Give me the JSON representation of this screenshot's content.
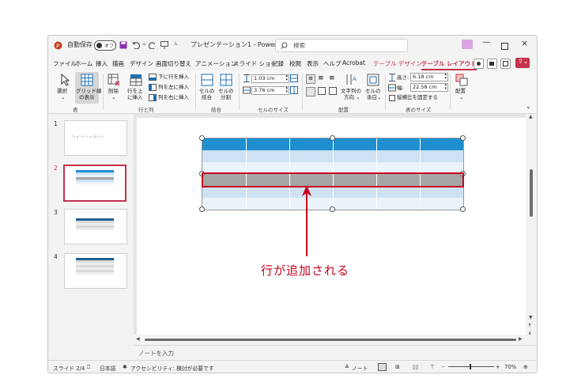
{
  "titlebar": {
    "autosave_label": "自動保存",
    "autosave_state": "オフ",
    "doc_title": "プレゼンテーション1 - Power…",
    "search_placeholder": "検索"
  },
  "menu": {
    "items": [
      "ファイル",
      "ホーム",
      "挿入",
      "描画",
      "デザイン",
      "画面切り替え",
      "アニメーション",
      "スライド ショー",
      "記録",
      "校閲",
      "表示",
      "ヘルプ",
      "Acrobat",
      "テーブル デザイン",
      "テーブル レイアウト"
    ],
    "active_index": 14
  },
  "ribbon": {
    "select": "選択",
    "gridlines_line1": "グリッド線",
    "gridlines_line2": "の表示",
    "delete": "削除",
    "insert_above_line1": "行を上",
    "insert_above_line2": "に挿入",
    "insert_below": "下に行を挿入",
    "insert_left": "列を左に挿入",
    "insert_right": "列を右に挿入",
    "merge_line1": "セルの",
    "merge_line2": "結合",
    "split_line1": "セルの",
    "split_line2": "分割",
    "row_height": "1.03 cm",
    "col_width": "3.76 cm",
    "text_dir_line1": "文字列の",
    "text_dir_line2": "方向",
    "margin_line1": "セルの",
    "margin_line2": "余白",
    "table_height_label": "高さ:",
    "table_height": "6.18 cm",
    "table_width_label": "幅:",
    "table_width": "22.58 cm",
    "lock_ratio": "縦横比を固定する",
    "arrange": "配置",
    "groups": {
      "table": "表",
      "rows_cols": "行と列",
      "merge": "結合",
      "cell_size": "セルのサイズ",
      "align": "配置",
      "table_size": "表のサイズ"
    }
  },
  "slides": {
    "numbers": [
      "1",
      "2",
      "3",
      "4"
    ],
    "thumb1_text": "プレゼンテーションタイトル",
    "selected": 2
  },
  "callout": "行が追加される",
  "notes_placeholder": "ノートを入力",
  "status": {
    "slide_info": "スライド 2/4",
    "language": "日本語",
    "accessibility": "アクセシビリティ: 検討が必要です",
    "notes": "ノート",
    "zoom": "70%"
  },
  "colors": {
    "header_blue": "#1f8fd0",
    "band_light": "#cfe2f3",
    "band_white": "#eaf2fa",
    "highlight_gray": "#a6a6a6",
    "callout_red": "#c6001e",
    "accent_red": "#c4314b"
  }
}
